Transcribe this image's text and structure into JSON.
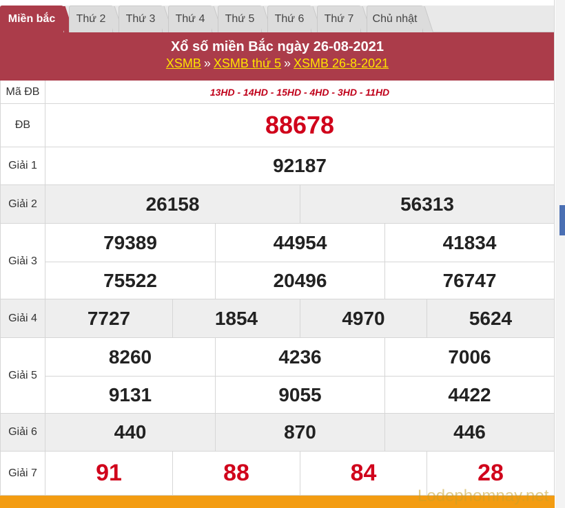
{
  "tabs": [
    "Miền bắc",
    "Thứ 2",
    "Thứ 3",
    "Thứ 4",
    "Thứ 5",
    "Thứ 6",
    "Thứ 7",
    "Chủ nhật"
  ],
  "header": {
    "title": "Xổ số miền Bắc ngày 26-08-2021",
    "crumb1": "XSMB",
    "sep": "»",
    "crumb2": "XSMB thứ 5",
    "crumb3": "XSMB 26-8-2021"
  },
  "rows": {
    "madb": {
      "label": "Mã ĐB",
      "value": "13HD - 14HD - 15HD - 4HD - 3HD - 11HD"
    },
    "db": {
      "label": "ĐB",
      "values": [
        "88678"
      ]
    },
    "g1": {
      "label": "Giải 1",
      "values": [
        "92187"
      ]
    },
    "g2": {
      "label": "Giải 2",
      "values": [
        "26158",
        "56313"
      ]
    },
    "g3": {
      "label": "Giải 3",
      "values": [
        "79389",
        "44954",
        "41834",
        "75522",
        "20496",
        "76747"
      ]
    },
    "g4": {
      "label": "Giải 4",
      "values": [
        "7727",
        "1854",
        "4970",
        "5624"
      ]
    },
    "g5": {
      "label": "Giải 5",
      "values": [
        "8260",
        "4236",
        "7006",
        "9131",
        "9055",
        "4422"
      ]
    },
    "g6": {
      "label": "Giải 6",
      "values": [
        "440",
        "870",
        "446"
      ]
    },
    "g7": {
      "label": "Giải 7",
      "values": [
        "91",
        "88",
        "84",
        "28"
      ]
    }
  },
  "watermark": "Lodephomnay.net",
  "colors": {
    "accent": "#ab3c4a",
    "link": "#ffe400",
    "red": "#d0021b",
    "orange": "#f39c12"
  }
}
